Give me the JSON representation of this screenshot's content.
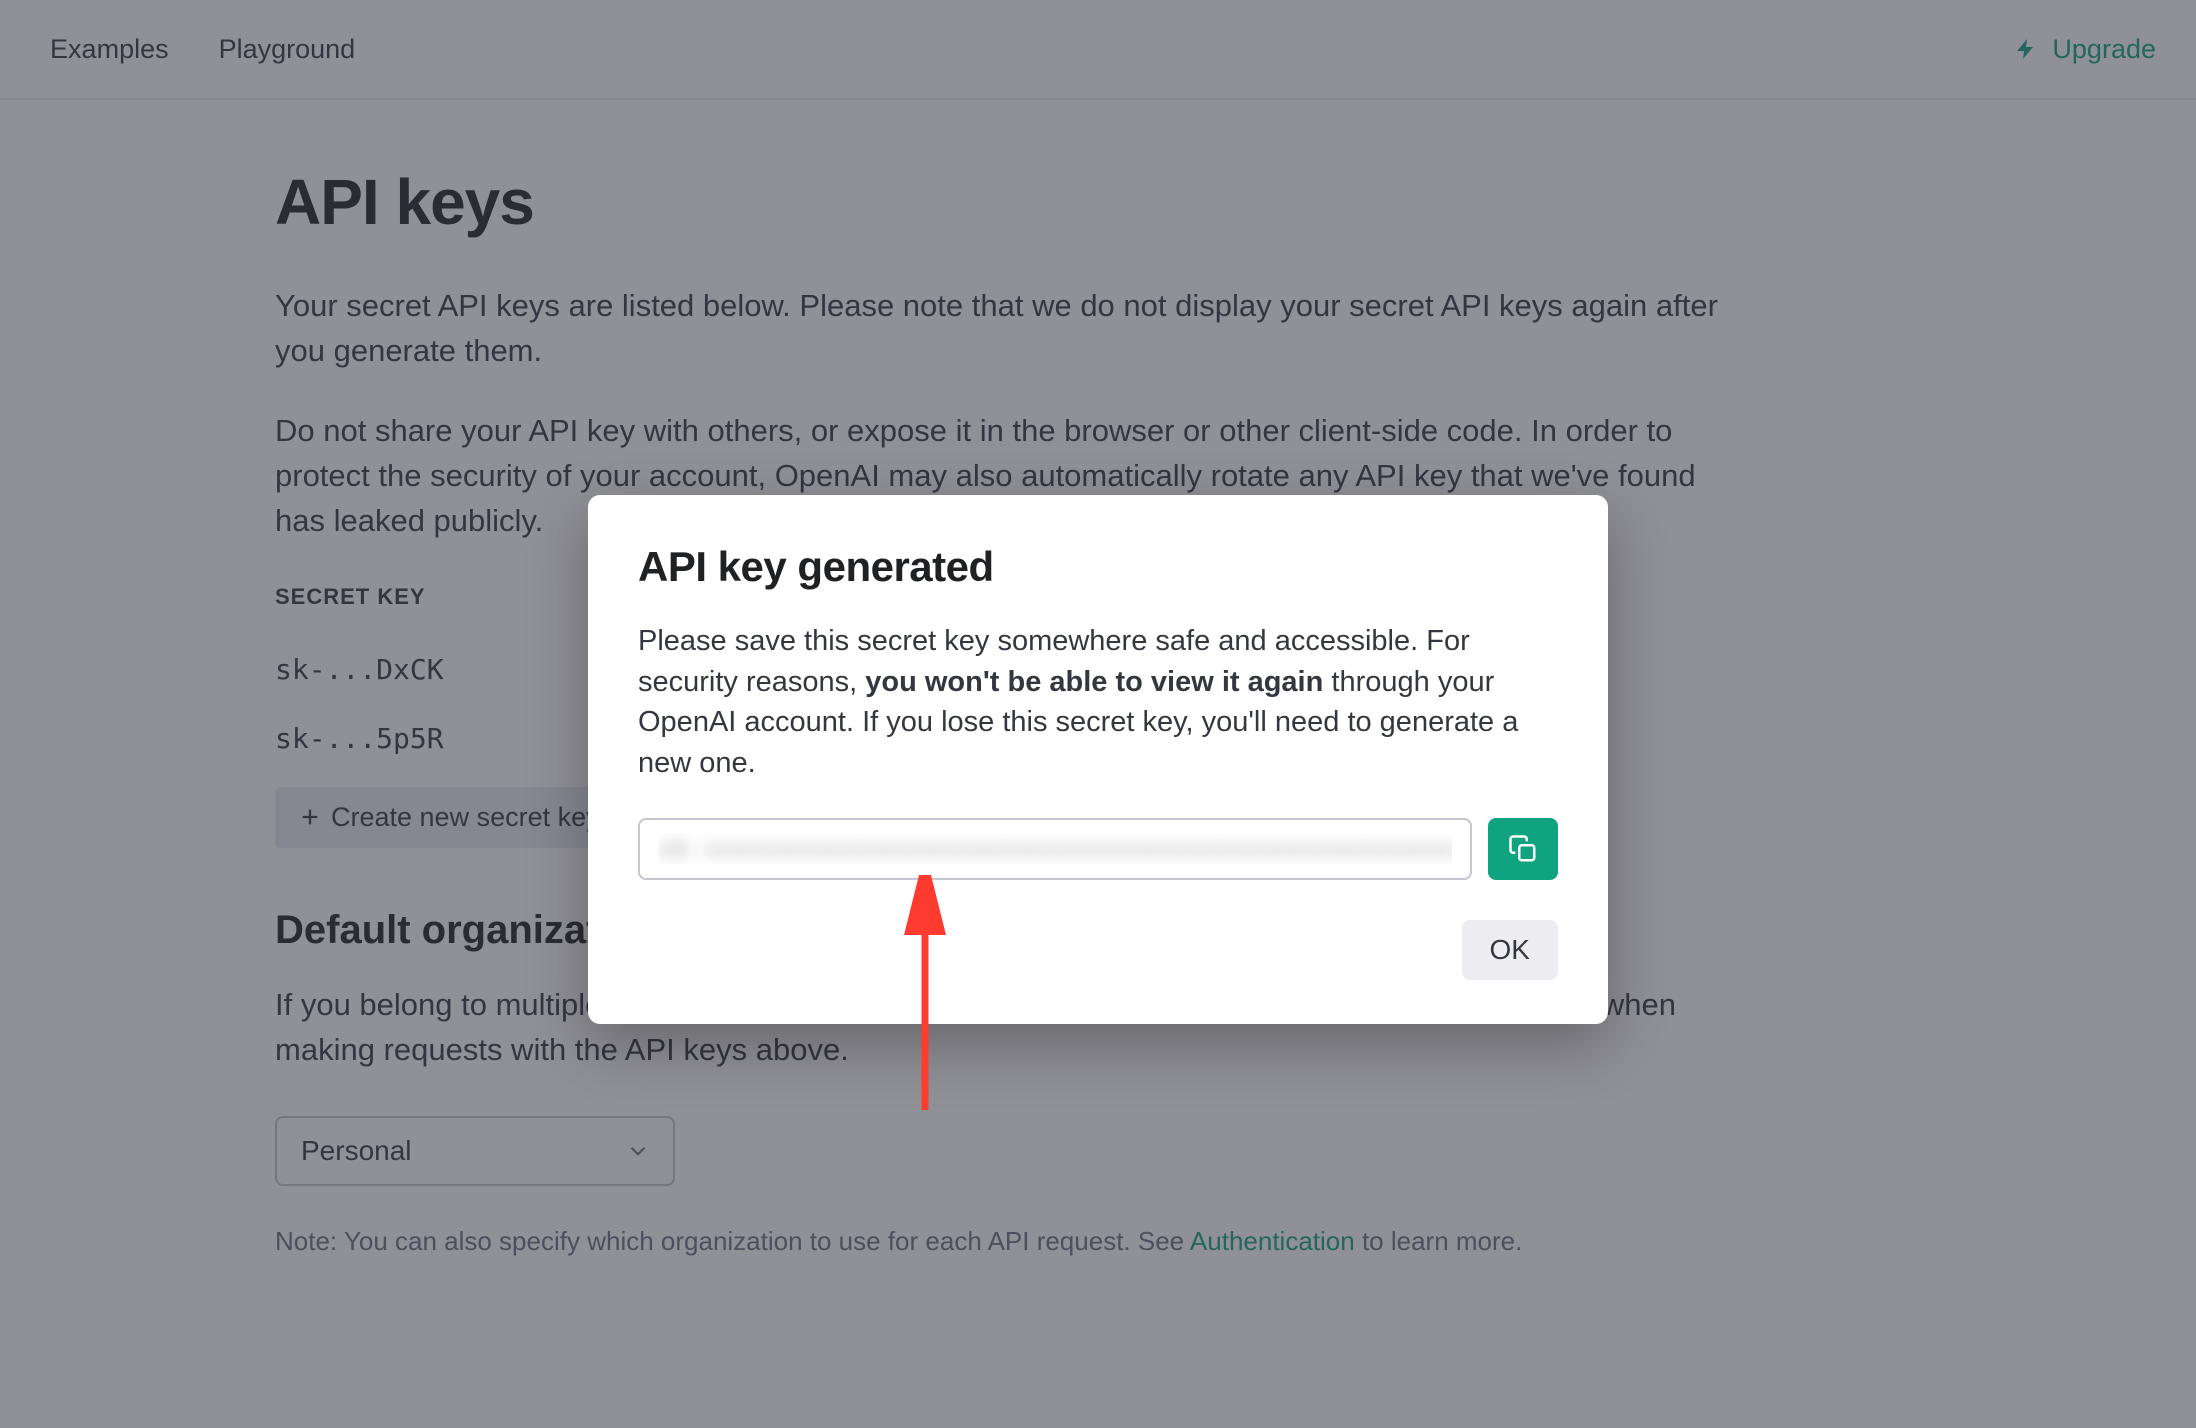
{
  "nav": {
    "item0": "on",
    "item1": "Examples",
    "item2": "Playground",
    "upgrade": "Upgrade"
  },
  "page": {
    "title": "API keys",
    "p1": "Your secret API keys are listed below. Please note that we do not display your secret API keys again after you generate them.",
    "p2": "Do not share your API key with others, or expose it in the browser or other client-side code. In order to protect the security of your account, OpenAI may also automatically rotate any API key that we've found has leaked publicly.",
    "table_header": "SECRET KEY",
    "keys": {
      "0": "sk-...DxCK",
      "1": "sk-...5p5R"
    },
    "create_label": "Create new secret key",
    "org_heading": "Default organization",
    "org_p": "If you belong to multiple organizations, this setting controls which organization is used by default when making requests with the API keys above.",
    "org_selected": "Personal",
    "footer_prefix": "Note: You can also specify which organization to use for each API request. See ",
    "footer_link": "Authentication",
    "footer_suffix": " to learn more."
  },
  "modal": {
    "title": "API key generated",
    "body_prefix": "Please save this secret key somewhere safe and accessible. For security reasons, ",
    "body_bold": "you won't be able to view it again",
    "body_suffix": " through your OpenAI account. If you lose this secret key, you'll need to generate a new one.",
    "key_value": "sk-xxxxxxxxxxxxxxxxxxxxxxxxxxxxxxxxxxxxxxxxxxxxxxxx",
    "ok": "OK"
  }
}
